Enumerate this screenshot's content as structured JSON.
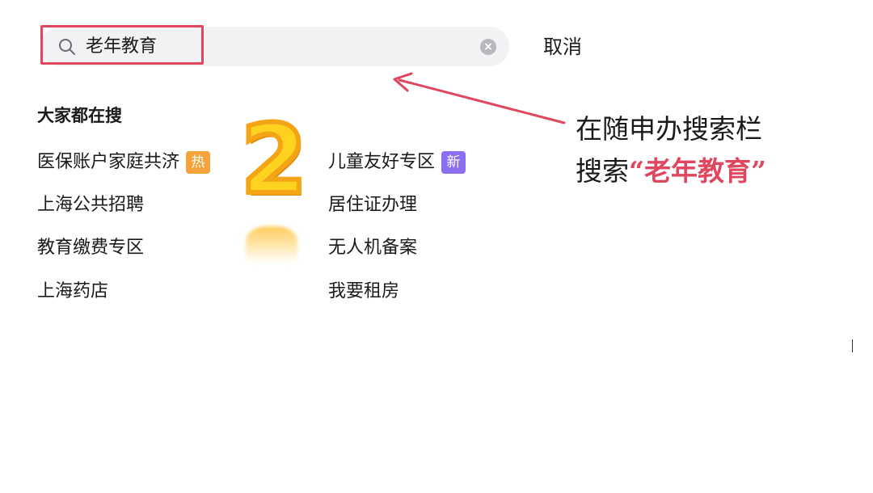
{
  "search": {
    "value": "老年教育",
    "icon": "search-icon",
    "clear_icon": "clear-icon",
    "clear_glyph": "×",
    "cancel_label": "取消"
  },
  "section": {
    "title": "大家都在搜"
  },
  "items_left": [
    {
      "label": "医保账户家庭共济",
      "badge": "热"
    },
    {
      "label": "上海公共招聘"
    },
    {
      "label": "教育缴费专区"
    },
    {
      "label": "上海药店"
    }
  ],
  "items_right": [
    {
      "label": "儿童友好专区",
      "badge": "新"
    },
    {
      "label": "居住证办理"
    },
    {
      "label": "无人机备案"
    },
    {
      "label": "我要租房"
    }
  ],
  "decoration": {
    "step_number": "2"
  },
  "annotation": {
    "line1": "在随申办搜索栏",
    "line2_prefix": "搜索",
    "line2_highlight": "“老年教育”"
  },
  "colors": {
    "highlight": "#e0475e",
    "hot_badge": "#f5a33b",
    "new_badge": "#8b6ff0",
    "step_number": "#ffd21f"
  }
}
